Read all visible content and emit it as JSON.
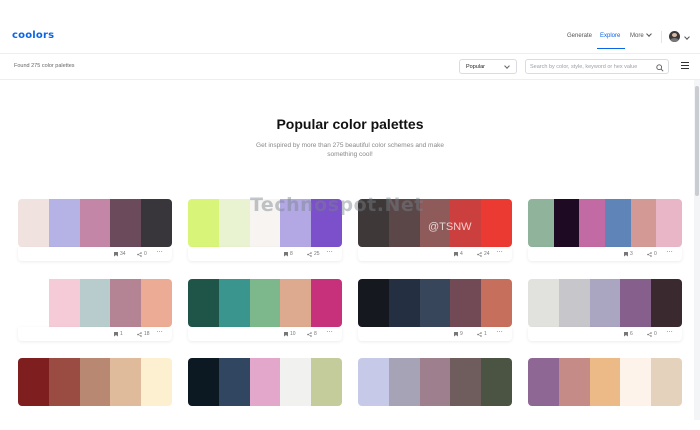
{
  "header": {
    "logo": "coolors",
    "nav": [
      {
        "label": "Generate",
        "active": false
      },
      {
        "label": "Explore",
        "active": true
      },
      {
        "label": "More",
        "active": false
      }
    ]
  },
  "subbar": {
    "found_text": "Found 275 color palettes",
    "sort_value": "Popular",
    "search_placeholder": "Search by color, style, keyword or hex value"
  },
  "hero": {
    "title": "Popular color palettes",
    "subtitle": "Get inspired by more than 275 beautiful color schemes and make something cool!"
  },
  "watermark": {
    "text": "Technospot.Net",
    "tag": "@TSNW"
  },
  "palettes": [
    {
      "colors": [
        "#f0e3df",
        "#b5b2e6",
        "#c386a6",
        "#6a4a5b",
        "#38353b"
      ],
      "saves": "34",
      "shares": "0"
    },
    {
      "colors": [
        "#d8f57a",
        "#e9f3d1",
        "#f7f4f1",
        "#b3a8e4",
        "#7c4fcb"
      ],
      "saves": "8",
      "shares": "25"
    },
    {
      "colors": [
        "#3e3838",
        "#5b4747",
        "#8e5a5a",
        "#cc3f3f",
        "#ea3a31"
      ],
      "saves": "4",
      "shares": "24"
    },
    {
      "colors": [
        "#8fb39b",
        "#1e0a22",
        "#c26aa3",
        "#5f84b8",
        "#d39a95",
        "#e9b6c8"
      ],
      "saves": "3",
      "shares": "0"
    },
    {
      "colors": [
        "#ffffff",
        "#f4cbd7",
        "#b8cccd",
        "#b48495",
        "#ebab95"
      ],
      "saves": "1",
      "shares": "18"
    },
    {
      "colors": [
        "#1f5449",
        "#3a958f",
        "#7cb88b",
        "#dda98f",
        "#c7317c"
      ],
      "saves": "10",
      "shares": "8"
    },
    {
      "colors": [
        "#16181f",
        "#243041",
        "#38465c",
        "#714a55",
        "#c66f5d"
      ],
      "saves": "9",
      "shares": "1"
    },
    {
      "colors": [
        "#e1e2de",
        "#c7c7cb",
        "#aaa5c0",
        "#875f8c",
        "#3a2a30"
      ],
      "saves": "6",
      "shares": "0"
    },
    {
      "colors": [
        "#7e1e1f",
        "#9a4b42",
        "#b88873",
        "#dfbb9b",
        "#fdf0d0"
      ],
      "saves": "",
      "shares": ""
    },
    {
      "colors": [
        "#0d1922",
        "#314660",
        "#e3a7cb",
        "#f1f2ef",
        "#c4cc9b"
      ],
      "saves": "",
      "shares": ""
    },
    {
      "colors": [
        "#c6cae8",
        "#a7a3b7",
        "#9e7f8d",
        "#6e5d5c",
        "#4b5443"
      ],
      "saves": "",
      "shares": ""
    },
    {
      "colors": [
        "#8e6795",
        "#c58b86",
        "#ecba86",
        "#fdf3ea",
        "#e5d2bc"
      ],
      "saves": "",
      "shares": ""
    }
  ]
}
